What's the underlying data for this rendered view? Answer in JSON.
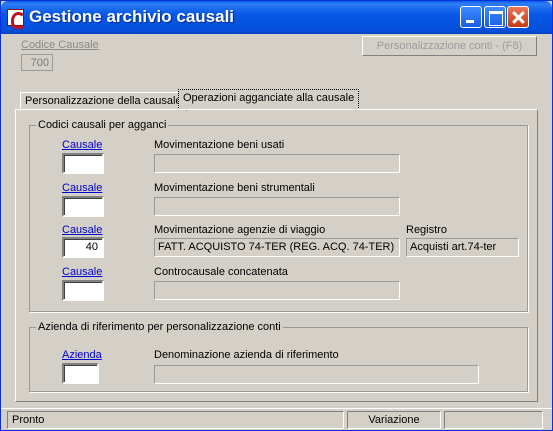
{
  "window": {
    "title": "Gestione archivio causali"
  },
  "header": {
    "code_label": "Codice Causale",
    "code_value": "700",
    "personalize_button": "Personalizzazione conti - (F8)"
  },
  "tabs": [
    {
      "label": "Personalizzazione della causale",
      "selected": false
    },
    {
      "label": "Operazioni agganciate alla causale",
      "selected": true
    }
  ],
  "group_codes": {
    "title": "Codici causali per agganci",
    "rows": [
      {
        "link": "Causale",
        "code": "",
        "label": "Movimentazione beni usati",
        "description": ""
      },
      {
        "link": "Causale",
        "code": "",
        "label": "Movimentazione beni strumentali",
        "description": ""
      },
      {
        "link": "Causale",
        "code": "40",
        "label": "Movimentazione agenzie di viaggio",
        "description": "FATT. ACQUISTO 74-TER (REG. ACQ. 74-TER)",
        "register_label": "Registro",
        "register_value": "Acquisti art.74-ter"
      },
      {
        "link": "Causale",
        "code": "",
        "label": "Controcausale concatenata",
        "description": ""
      }
    ]
  },
  "group_company": {
    "title": "Azienda di riferimento per personalizzazione conti",
    "link": "Azienda",
    "code": "",
    "label": "Denominazione azienda di riferimento",
    "description": ""
  },
  "statusbar": {
    "status": "Pronto",
    "mode": "Variazione",
    "extra": ""
  }
}
